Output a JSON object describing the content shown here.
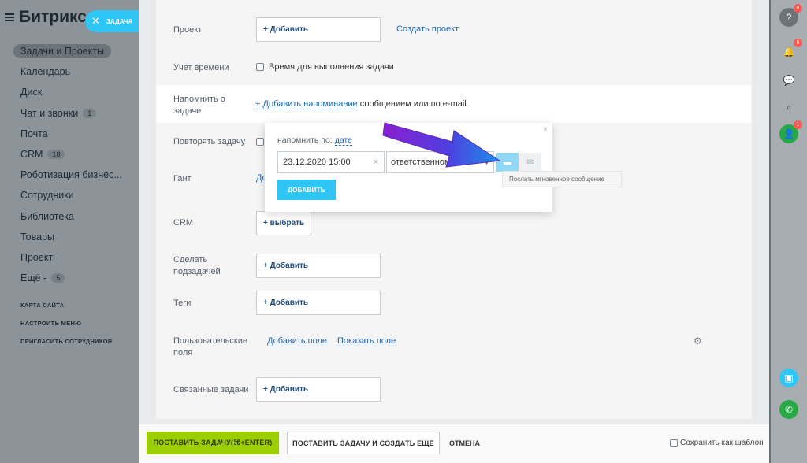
{
  "sidebar": {
    "brand": "Битрикс 24",
    "items": [
      {
        "label": "Задачи и Проекты",
        "active": true
      },
      {
        "label": "Календарь"
      },
      {
        "label": "Диск"
      },
      {
        "label": "Чат и звонки",
        "counter": "1"
      },
      {
        "label": "Почта"
      },
      {
        "label": "CRM",
        "counter": "18"
      },
      {
        "label": "Роботизация бизнес..."
      },
      {
        "label": "Сотрудники"
      },
      {
        "label": "Библиотека"
      },
      {
        "label": "Товары"
      },
      {
        "label": "Проект"
      },
      {
        "label": "Ещё -",
        "counter": "5"
      }
    ],
    "links": [
      "КАРТА САЙТА",
      "НАСТРОИТЬ МЕНЮ",
      "ПРИГЛАСИТЬ СОТРУДНИКОВ"
    ]
  },
  "task_tag": {
    "label": "ЗАДАЧА"
  },
  "rightbar": {
    "help_badge": "8",
    "notify_badge": "6",
    "user_badge": "1"
  },
  "form": {
    "project": {
      "label": "Проект",
      "add": "+ Добавить",
      "create": "Создать проект"
    },
    "time": {
      "label": "Учет времени",
      "checkbox": "Время для выполнения задачи"
    },
    "remind": {
      "label": "Напомнить о задаче",
      "link": "+ Добавить напоминание",
      "rest": "сообщением или по e-mail"
    },
    "repeat": {
      "label": "Повторять задачу"
    },
    "gantt": {
      "label": "Гант",
      "link": "До"
    },
    "crm": {
      "label": "CRM",
      "button": "+ выбрать"
    },
    "subtask": {
      "label": "Сделать подзадачей",
      "add": "+ Добавить"
    },
    "tags": {
      "label": "Теги",
      "add": "+ Добавить"
    },
    "custom": {
      "label": "Пользовательские поля",
      "add_field": "Добавить поле",
      "show_field": "Показать поле"
    },
    "related": {
      "label": "Связанные задачи",
      "add": "+ Добавить"
    }
  },
  "popup": {
    "remind_by": "напомнить по:",
    "remind_by_value": "дате",
    "datetime": "23.12.2020 15:00",
    "recipient": "ответственному",
    "add_button": "ДОБАВИТЬ",
    "tooltip": "Послать мгновенное сообщение"
  },
  "footer": {
    "submit": "ПОСТАВИТЬ ЗАДАЧУ(⌘+ENTER)",
    "submit_more": "ПОСТАВИТЬ ЗАДАЧУ И СОЗДАТЬ ЕЩЕ",
    "cancel": "ОТМЕНА",
    "save_template": "Сохранить как шаблон"
  },
  "colors": {
    "accent": "#2fc6f6",
    "submit": "#9dcf00",
    "link": "#2067b0",
    "badge": "#ff5752"
  }
}
